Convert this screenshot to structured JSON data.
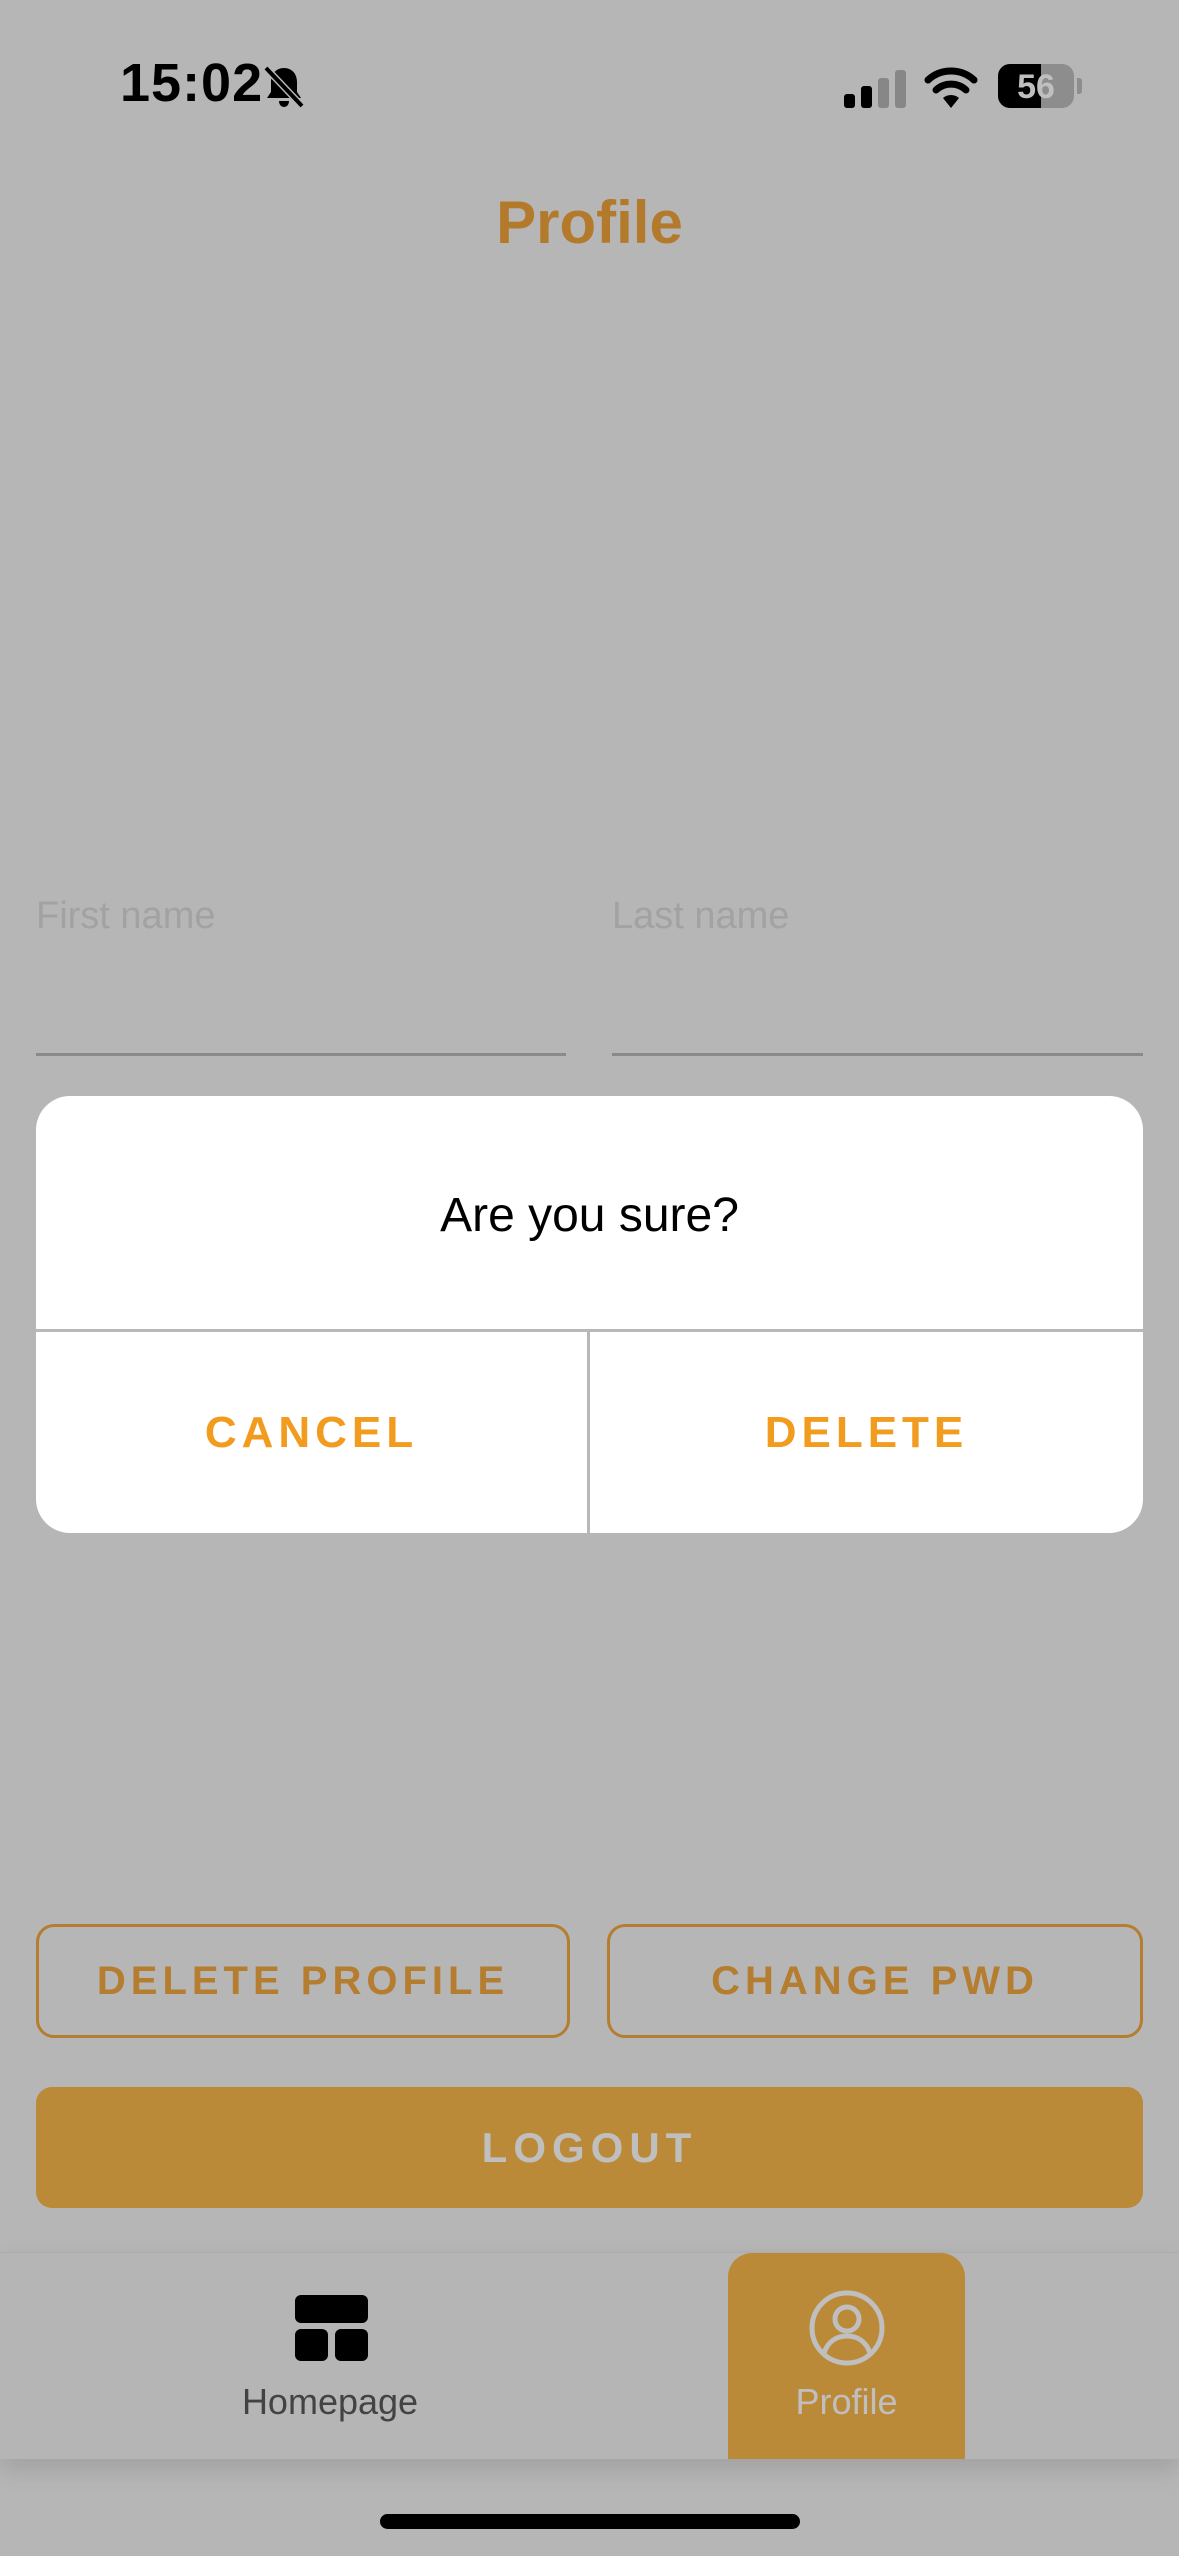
{
  "status_bar": {
    "time": "15:02",
    "battery_level": "56",
    "icons": [
      "bell-slash-icon",
      "cellular-signal-icon",
      "wifi-icon",
      "battery-icon"
    ]
  },
  "header": {
    "title": "Profile"
  },
  "form": {
    "first_name_placeholder": "First name",
    "last_name_placeholder": "Last name"
  },
  "actions": {
    "delete_profile_label": "DELETE PROFILE",
    "change_pwd_label": "CHANGE PWD",
    "logout_label": "LOGOUT"
  },
  "tab_bar": {
    "tabs": [
      {
        "label": "Homepage",
        "icon": "dashboard-icon",
        "active": false
      },
      {
        "label": "Profile",
        "icon": "profile-icon",
        "active": true
      }
    ]
  },
  "dialog": {
    "message": "Are you sure?",
    "cancel_label": "CANCEL",
    "delete_label": "DELETE"
  },
  "colors": {
    "accent": "#F2A73F",
    "logout_background": "#FAB84C",
    "dialog_button_text": "#F19C1F",
    "scrim": "rgba(0,0,0,0.25)"
  }
}
